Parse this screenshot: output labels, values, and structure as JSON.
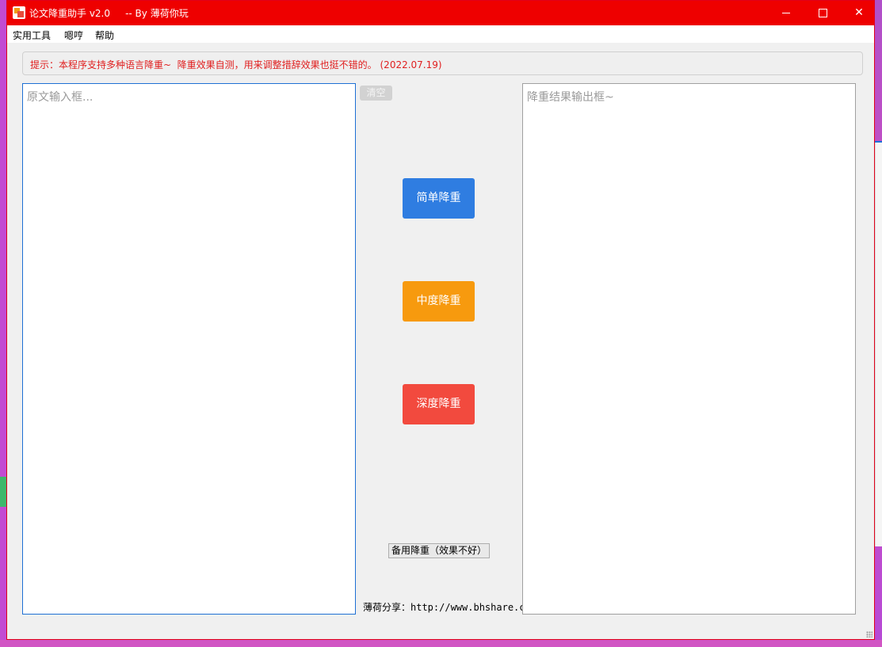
{
  "window": {
    "title": "论文降重助手 v2.0     -- By 薄荷你玩",
    "controls": {
      "minimize": "minimize",
      "maximize": "maximize",
      "close": "✕"
    }
  },
  "menu": {
    "items": [
      "实用工具",
      "嗯哼",
      "帮助"
    ]
  },
  "tip": "提示：本程序支持多种语言降重~  降重效果自测，用来调整措辞效果也挺不错的。 (2022.07.19)",
  "input": {
    "placeholder": "原文输入框..."
  },
  "output": {
    "placeholder": "降重结果输出框~"
  },
  "buttons": {
    "clear": "清空",
    "simple": "简单降重",
    "medium": "中度降重",
    "deep": "深度降重",
    "backup": "备用降重（效果不好）"
  },
  "share": "薄荷分享：http://www.bhshare.cn/",
  "colors": {
    "titlebar": "#ee0000",
    "simple": "#2f7de1",
    "medium": "#f79a0e",
    "deep": "#f24a3e",
    "tip": "#e02020"
  }
}
